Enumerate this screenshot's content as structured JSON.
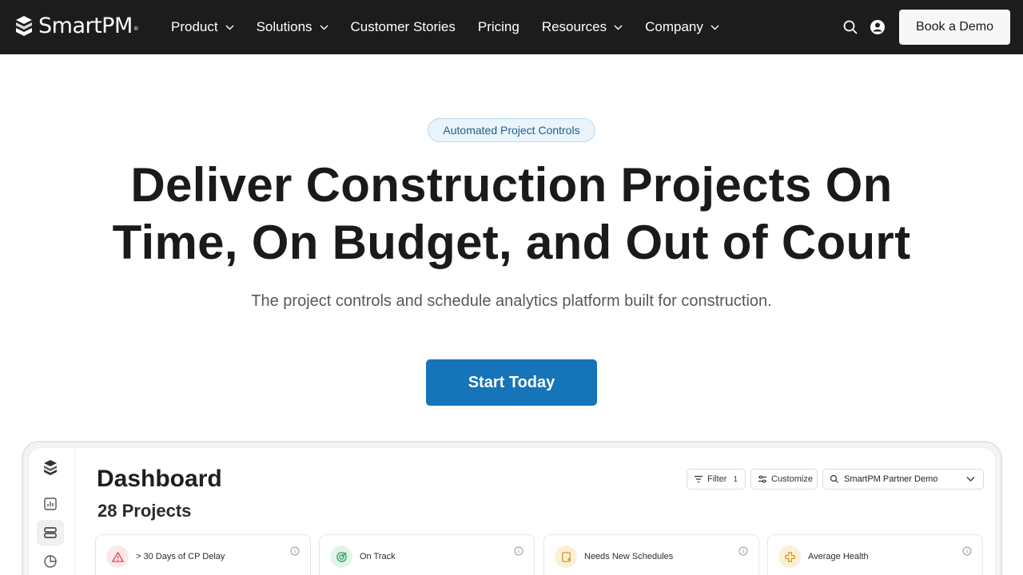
{
  "brand": {
    "name": "SmartPM",
    "trademark": "®"
  },
  "nav": {
    "items": [
      {
        "label": "Product",
        "has_dropdown": true
      },
      {
        "label": "Solutions",
        "has_dropdown": true
      },
      {
        "label": "Customer Stories",
        "has_dropdown": false
      },
      {
        "label": "Pricing",
        "has_dropdown": false
      },
      {
        "label": "Resources",
        "has_dropdown": true
      },
      {
        "label": "Company",
        "has_dropdown": true
      }
    ],
    "icons": [
      "search-icon",
      "account-icon"
    ],
    "demo_button": "Book a Demo"
  },
  "hero": {
    "badge": "Automated Project Controls",
    "headline_line1": "Deliver Construction Projects On",
    "headline_line2": "Time, On Budget, and Out of Court",
    "subhead": "The project controls and schedule analytics platform built for construction.",
    "cta": "Start Today"
  },
  "dashboard": {
    "title": "Dashboard",
    "project_count": "28 Projects",
    "filter_label": "Filter",
    "filter_count": "1",
    "customize_label": "Customize",
    "project_select": "SmartPM Partner Demo",
    "sidebar_icons": [
      "logo-icon",
      "chart-icon",
      "layers-icon",
      "pie-icon"
    ],
    "cards": [
      {
        "label": "> 30 Days of CP Delay",
        "icon": "warning-icon",
        "color": "#e24b4b",
        "bg": "#fde8e8"
      },
      {
        "label": "On Track",
        "icon": "target-icon",
        "color": "#2f9e5b",
        "bg": "#e3f5ea"
      },
      {
        "label": "Needs New Schedules",
        "icon": "schedule-icon",
        "color": "#d49a1c",
        "bg": "#fbf0d6"
      },
      {
        "label": "Average Health",
        "icon": "health-icon",
        "color": "#d49a1c",
        "bg": "#fbf0d6"
      }
    ]
  },
  "colors": {
    "nav_bg": "#1c1c1c",
    "accent": "#1674b8",
    "badge_text": "#1d5f8e"
  }
}
